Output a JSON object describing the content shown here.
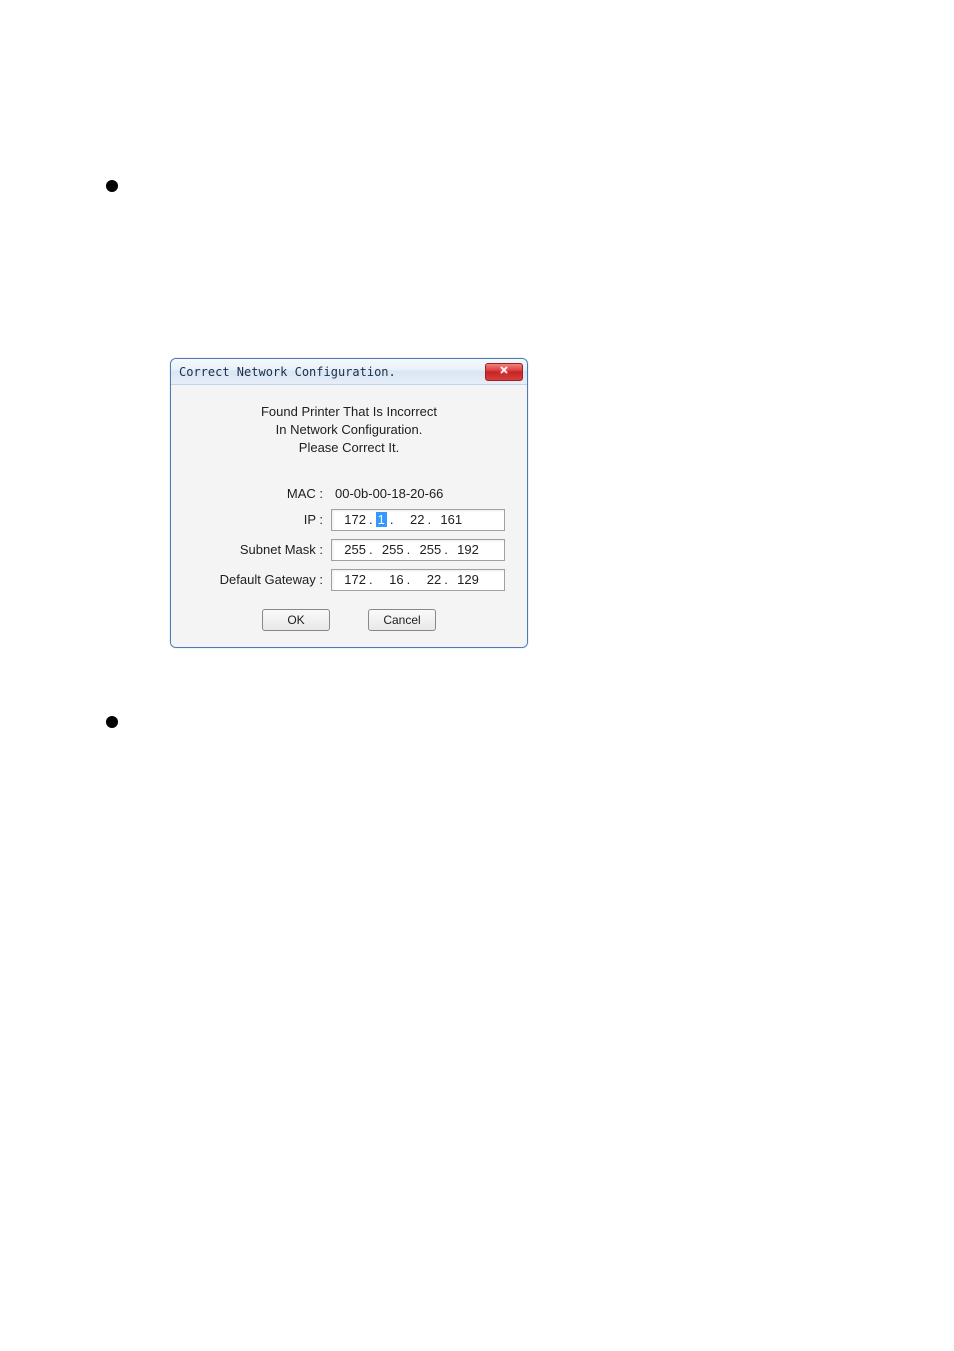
{
  "dialog": {
    "title": "Correct Network Configuration.",
    "message": {
      "line1": "Found Printer That Is Incorrect",
      "line2": "In Network Configuration.",
      "line3": "Please Correct It."
    },
    "mac": {
      "label": "MAC :",
      "value": "00-0b-00-18-20-66"
    },
    "ip": {
      "label": "IP :",
      "oct1": "172",
      "oct2": "1",
      "oct3": "22",
      "oct4": "161"
    },
    "subnet": {
      "label": "Subnet Mask :",
      "oct1": "255",
      "oct2": "255",
      "oct3": "255",
      "oct4": "192"
    },
    "gateway": {
      "label": "Default Gateway :",
      "oct1": "172",
      "oct2": "16",
      "oct3": "22",
      "oct4": "129"
    },
    "buttons": {
      "ok": "OK",
      "cancel": "Cancel"
    }
  }
}
